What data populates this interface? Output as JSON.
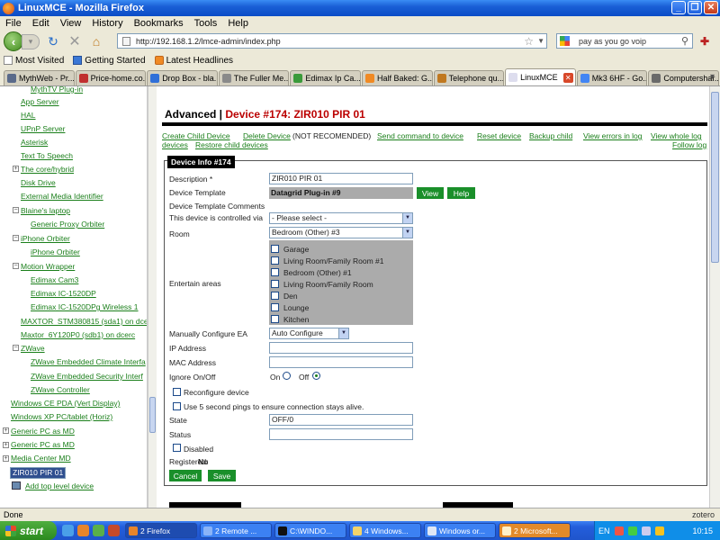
{
  "window": {
    "title": "LinuxMCE - Mozilla Firefox"
  },
  "menu": [
    "File",
    "Edit",
    "View",
    "History",
    "Bookmarks",
    "Tools",
    "Help"
  ],
  "nav": {
    "url": "http://192.168.1.2/lmce-admin/index.php",
    "search_placeholder": "pay as you go voip"
  },
  "bookmarks": [
    "Most Visited",
    "Getting Started",
    "Latest Headlines"
  ],
  "tabs": [
    "MythWeb - Pr...",
    "Price-home.co...",
    "Drop Box - bla...",
    "The Fuller Me...",
    "Edimax Ip Ca...",
    "Half Baked: G...",
    "Telephone qu...",
    "LinuxMCE",
    "Mk3 6HF - Go...",
    "Computershar..."
  ],
  "sidebar": {
    "items": [
      "MythTV Plug-in",
      "App Server",
      "HAL",
      "UPnP Server",
      "Asterisk",
      "Text To Speech",
      "The core/hybrid",
      "Disk Drive",
      "External Media Identifier",
      "Blaine's laptop",
      "Generic Proxy Orbiter",
      "iPhone Orbiter",
      "iPhone Orbiter",
      "Motion Wrapper",
      "Edimax Cam3",
      "Edimax IC-1520DP",
      "Edimax IC-1520DPg Wireless 1",
      "MAXTOR_STM380815 (sda1) on dcer",
      "Maxtor_6Y120P0 (sdb1) on dcerc",
      "ZWave",
      "ZWave Embedded Climate Interfa",
      "ZWave Embedded Security Interf",
      "ZWave Controller",
      "Windows CE PDA (Vert Display)",
      "Windows XP PC/tablet (Horiz)",
      "Generic PC as MD",
      "Generic PC as MD",
      "Media Center MD",
      "ZIR010 PIR 01",
      "Add top level device"
    ]
  },
  "main": {
    "heading_prefix": "Advanced |",
    "heading_device": "Device #174: ZIR010 PIR 01",
    "actions": {
      "create_child": "Create Child Device",
      "delete_device": "Delete Device",
      "not_recommended": "(NOT RECOMENDED)",
      "send_command": "Send command to device",
      "reset_device": "Reset device",
      "backup_child": "Backup child",
      "view_errors": "View errors in log",
      "view_whole_log": "View whole log",
      "devices": "devices",
      "restore_child": "Restore child devices",
      "follow_log": "Follow log"
    },
    "box_title": "Device Info #174",
    "fields": {
      "description_label": "Description *",
      "description_value": "ZIR010 PIR 01",
      "template_label": "Device Template",
      "template_value": "Datagrid Plug-in #9",
      "view_button": "View",
      "help_button": "Help",
      "template_comments_label": "Device Template Comments",
      "controlled_via_label": "This device is controlled via",
      "controlled_via_value": "- Please select -",
      "room_label": "Room",
      "room_value": "Bedroom (Other) #3",
      "entertain_label": "Entertain areas",
      "entertain_areas": [
        "Garage",
        "Living Room/Family Room #1",
        "Bedroom (Other) #1",
        "Living Room/Family Room",
        "Den",
        "Lounge",
        "Kitchen"
      ],
      "manual_ea_label": "Manually Configure EA",
      "manual_ea_value": "Auto Configure",
      "ip_label": "IP Address",
      "mac_label": "MAC Address",
      "ignore_label": "Ignore On/Off",
      "on_label": "On",
      "off_label": "Off",
      "reconfigure_label": "Reconfigure device",
      "pings_label": "Use 5 second pings to ensure connection stays alive.",
      "state_label": "State",
      "state_value": "OFF/0",
      "status_label": "Status",
      "disabled_label": "Disabled",
      "registered_label": "Registered:",
      "registered_value": "No",
      "cancel_button": "Cancel",
      "save_button": "Save"
    }
  },
  "statusbar": {
    "text": "Done",
    "zotero": "zotero"
  },
  "taskbar": {
    "start": "start",
    "tasks": [
      "2 Firefox",
      "2 Remote ...",
      "C:\\WINDO...",
      "4 Windows...",
      "Windows or...",
      "2 Microsoft..."
    ],
    "lang": "EN",
    "clock": "10:15"
  }
}
